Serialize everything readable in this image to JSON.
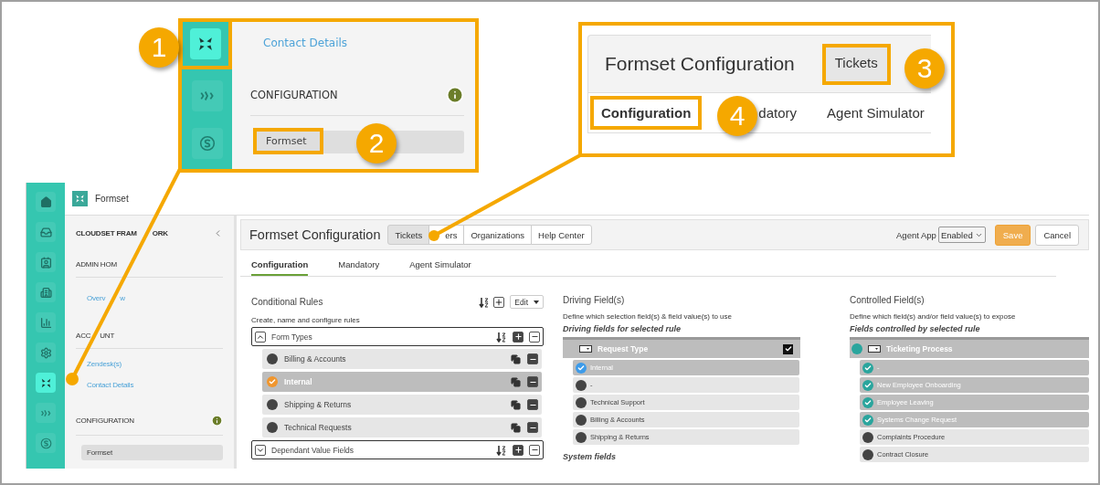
{
  "callouts": [
    {
      "number": "1"
    },
    {
      "number": "2"
    },
    {
      "number": "3"
    },
    {
      "number": "4"
    }
  ],
  "nav_zoom": {
    "link": "Contact Details",
    "section": "CONFIGURATION",
    "item": "Formset",
    "icons": [
      {
        "kind": "formset",
        "selected": true
      },
      {
        "kind": "relay",
        "selected": false
      },
      {
        "kind": "sunshine",
        "selected": false
      }
    ]
  },
  "header_zoom": {
    "title": "Formset Configuration",
    "tab": "Tickets",
    "subtabs": [
      {
        "label": "Configuration",
        "selected": true
      },
      {
        "label": "datory",
        "selected": false
      },
      {
        "label": "Agent Simulator",
        "selected": false
      }
    ]
  },
  "app": {
    "app_title": "Formset",
    "sidebar_icons": [
      {
        "kind": "home",
        "selected": false
      },
      {
        "kind": "inbox",
        "selected": false
      },
      {
        "kind": "contacts",
        "selected": false
      },
      {
        "kind": "building",
        "selected": false
      },
      {
        "kind": "chart",
        "selected": false
      },
      {
        "kind": "gear",
        "selected": false
      },
      {
        "kind": "formset",
        "selected": true
      },
      {
        "kind": "relay",
        "selected": false
      },
      {
        "kind": "sunshine",
        "selected": false
      }
    ],
    "nav": {
      "heading": [
        "CLOUDSET FRAM",
        "ORK"
      ],
      "sections": [
        {
          "title": [
            "ADMIN HOM"
          ],
          "info": false,
          "items": [
            {
              "label": [
                "Overv",
                "w"
              ],
              "selected": false
            }
          ]
        },
        {
          "title": [
            "ACC",
            "UNT"
          ],
          "info": false,
          "items": [
            {
              "label": [
                "Zendesk(s)"
              ],
              "selected": false
            },
            {
              "label": [
                "Contact Details"
              ],
              "selected": false
            }
          ]
        },
        {
          "title": [
            "CONFIGURATION"
          ],
          "info": true,
          "items": [
            {
              "label": [
                "Formset"
              ],
              "selected": true
            }
          ]
        }
      ]
    },
    "title": "Formset Configuration",
    "tabs": [
      {
        "label": "Tickets",
        "selected": true
      },
      {
        "label": "ers",
        "selected": false
      },
      {
        "label": "Organizations",
        "selected": false
      },
      {
        "label": "Help Center",
        "selected": false
      }
    ],
    "agent_app": {
      "label": "Agent App",
      "value": "Enabled"
    },
    "buttons": [
      {
        "kind": "primary",
        "label": "Save"
      },
      {
        "kind": "default",
        "label": "Cancel"
      }
    ],
    "subtabs": [
      {
        "label": "Configuration",
        "selected": true
      },
      {
        "label": "Mandatory",
        "selected": false
      },
      {
        "label": "Agent Simulator",
        "selected": false
      }
    ],
    "rules": {
      "title": "Conditional Rules",
      "edit": "Edit",
      "hint": "Create, name and configure rules",
      "groups": [
        {
          "label": "Form Types",
          "expanded": true,
          "children": [
            {
              "label": "Billing & Accounts",
              "selected": false
            },
            {
              "label": "Internal",
              "selected": true
            },
            {
              "label": "Shipping & Returns",
              "selected": false
            },
            {
              "label": "Technical Requests",
              "selected": false
            }
          ]
        },
        {
          "label": "Dependant Value Fields",
          "expanded": false
        }
      ]
    },
    "driving": {
      "title": "Driving Field(s)",
      "hint": "Define which selection field(s) & field value(s) to use",
      "subtitle": "Driving fields for selected rule",
      "field": {
        "label": "Request Type",
        "checked": true
      },
      "values": [
        {
          "label": "Internal",
          "checked": true
        },
        {
          "label": "-",
          "checked": false
        },
        {
          "label": "Technical Support",
          "checked": false
        },
        {
          "label": "Billing & Accounts",
          "checked": false
        },
        {
          "label": "Shipping & Returns",
          "checked": false
        }
      ],
      "footer": "System fields"
    },
    "controlled": {
      "title": "Controlled Field(s)",
      "hint": "Define which field(s) and/or field value(s) to expose",
      "subtitle": "Fields controlled by selected rule",
      "field": {
        "label": "Ticketing Process",
        "checked": true
      },
      "values": [
        {
          "label": "-",
          "checked": true
        },
        {
          "label": "New Employee Onboarding",
          "checked": true
        },
        {
          "label": "Employee Leaving",
          "checked": true
        },
        {
          "label": "Systems Change Request",
          "checked": true
        },
        {
          "label": "Complaints Procedure",
          "checked": false
        },
        {
          "label": "Contract Closure",
          "checked": false
        }
      ]
    }
  }
}
